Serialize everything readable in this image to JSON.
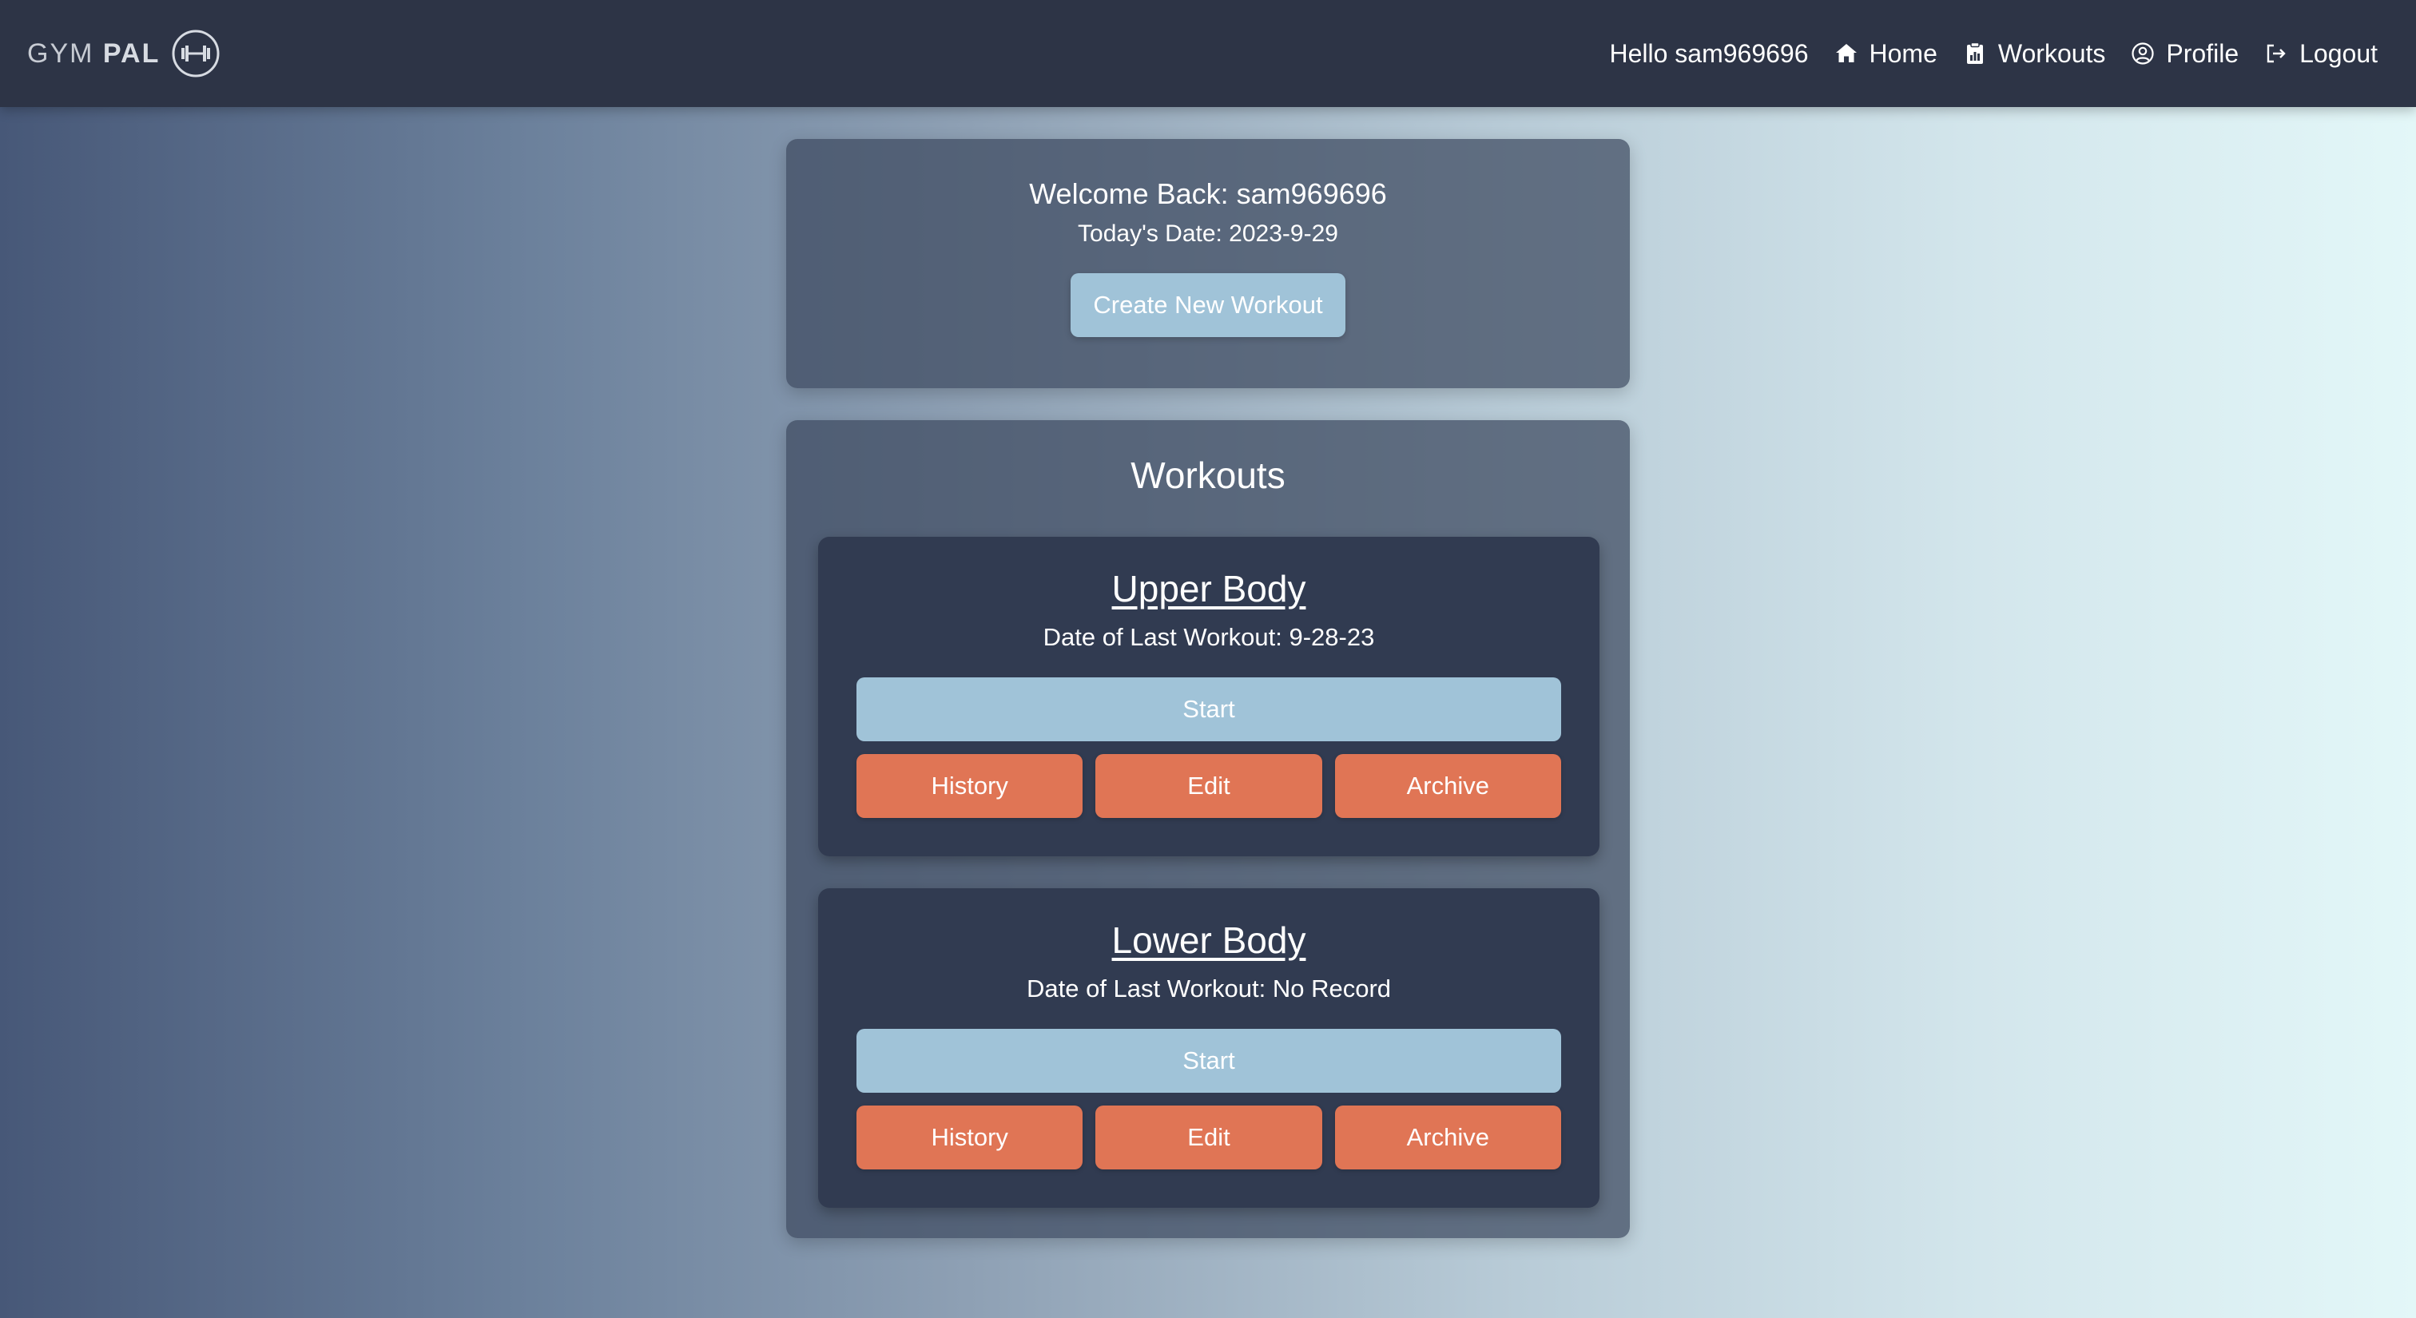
{
  "brand": {
    "name_light": "GYM",
    "name_bold": "PAL",
    "logo_icon": "dumbbell-circle-icon"
  },
  "nav": {
    "greeting": "Hello sam969696",
    "items": [
      {
        "label": "Home",
        "icon": "home-icon"
      },
      {
        "label": "Workouts",
        "icon": "clipboard-icon"
      },
      {
        "label": "Profile",
        "icon": "user-circle-icon"
      },
      {
        "label": "Logout",
        "icon": "logout-icon"
      }
    ]
  },
  "welcome": {
    "title": "Welcome Back: sam969696",
    "date": "Today's Date: 2023-9-29",
    "create_button": "Create New Workout"
  },
  "workouts": {
    "heading": "Workouts",
    "items": [
      {
        "name": "Upper Body",
        "last_workout": "Date of Last Workout: 9-28-23",
        "start_label": "Start",
        "history_label": "History",
        "edit_label": "Edit",
        "archive_label": "Archive"
      },
      {
        "name": "Lower Body",
        "last_workout": "Date of Last Workout: No Record",
        "start_label": "Start",
        "history_label": "History",
        "edit_label": "Edit",
        "archive_label": "Archive"
      }
    ]
  },
  "colors": {
    "navbar": "#2d3446",
    "card": "#313b51",
    "primary_button": "#a0c3d8",
    "action_button": "#e07555"
  }
}
